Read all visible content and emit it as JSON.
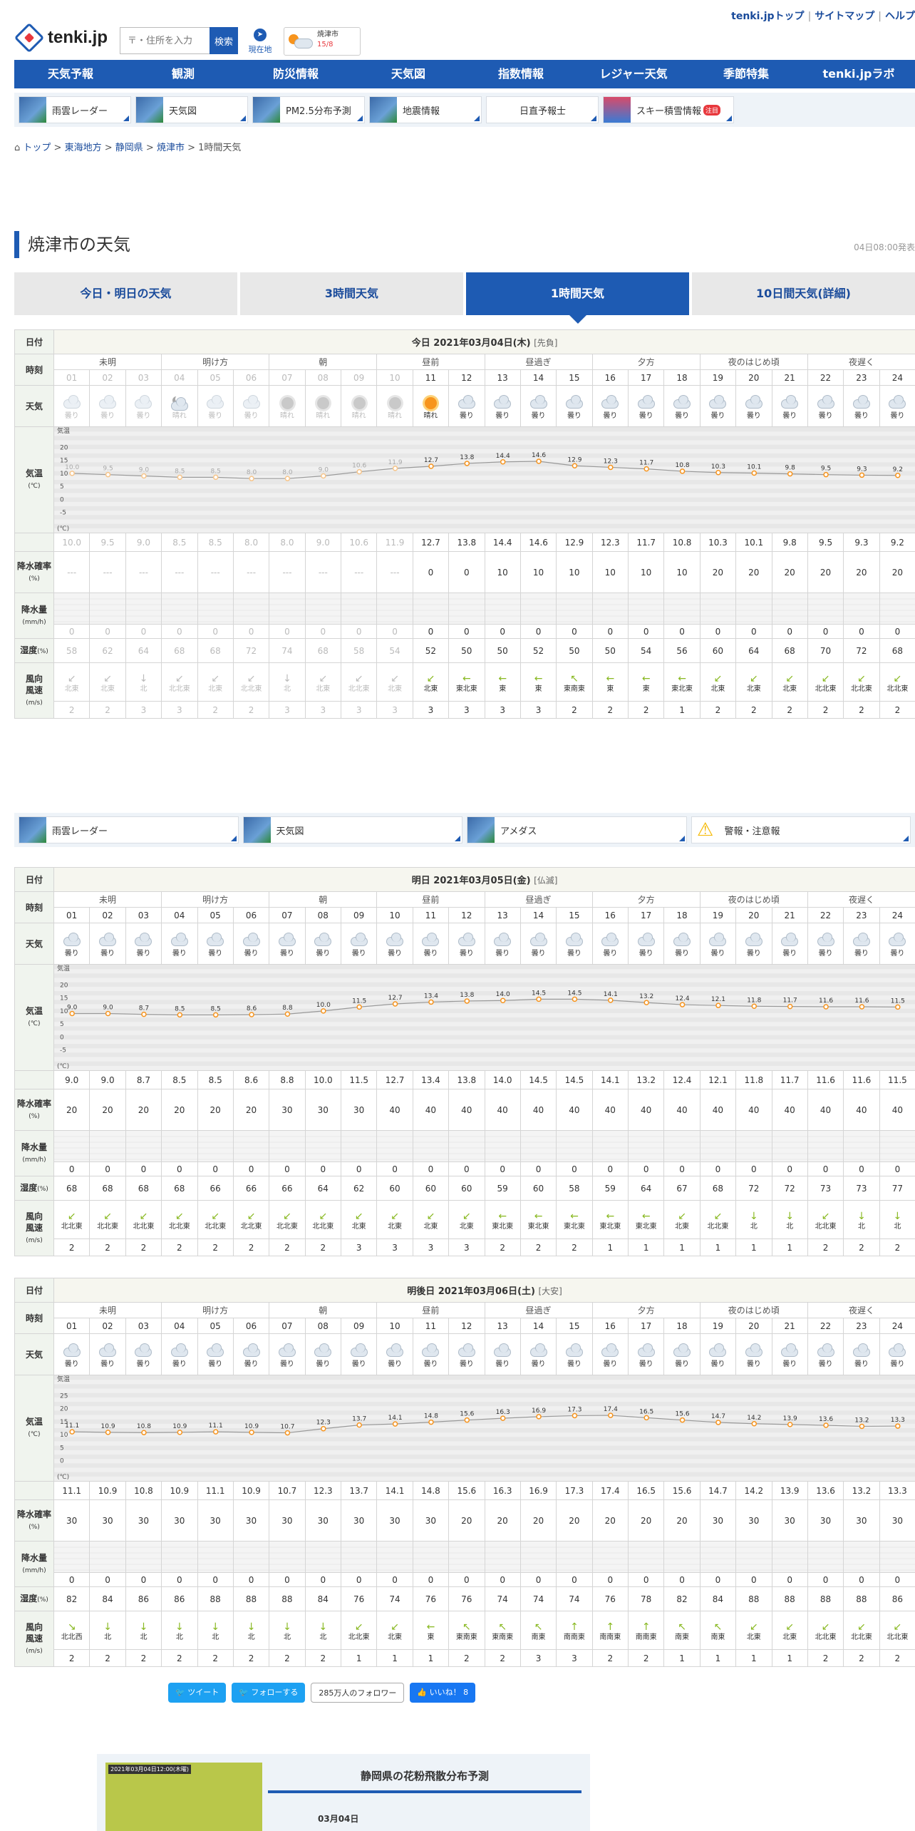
{
  "header": {
    "logo": "tenki.jp",
    "search_placeholder": "〒・住所を入力",
    "search_button": "検索",
    "current_location": "現在地",
    "mini_city": "焼津市",
    "mini_temps": "15/8",
    "top_links": [
      "tenki.jpトップ",
      "サイトマップ",
      "ヘルプ"
    ]
  },
  "global_nav": [
    "天気予報",
    "観測",
    "防災情報",
    "天気図",
    "指数情報",
    "レジャー天気",
    "季節特集",
    "tenki.jpラボ"
  ],
  "sub_nav_1": [
    {
      "label": "雨雲レーダー"
    },
    {
      "label": "天気図"
    },
    {
      "label": "PM2.5分布予測"
    },
    {
      "label": "地震情報"
    },
    {
      "label": "日直予報士"
    },
    {
      "label": "スキー積雪情報",
      "badge": "注目"
    }
  ],
  "sub_nav_2": [
    {
      "label": "雨雲レーダー"
    },
    {
      "label": "天気図"
    },
    {
      "label": "アメダス"
    },
    {
      "label": "警報・注意報"
    }
  ],
  "breadcrumb": [
    "トップ",
    "東海地方",
    "静岡県",
    "焼津市",
    "1時間天気"
  ],
  "page": {
    "title": "焼津市の天気",
    "issued": "04日08:00発表"
  },
  "tabs": [
    "今日・明日の天気",
    "3時間天気",
    "1時間天気",
    "10日間天気(詳細)"
  ],
  "row_labels": {
    "date": "日付",
    "time": "時刻",
    "weather": "天気",
    "temp": "気温",
    "temp_unit": "(℃)",
    "prob": "降水確率",
    "prob_unit": "(%)",
    "precip": "降水量",
    "precip_unit": "(mm/h)",
    "humidity": "湿度",
    "humidity_unit": "(%)",
    "wind_dir": "風向",
    "wind_speed": "風速",
    "wind_unit": "(m/s)"
  },
  "periods": [
    "未明",
    "明け方",
    "朝",
    "昼前",
    "昼過ぎ",
    "夕方",
    "夜のはじめ頃",
    "夜遅く"
  ],
  "hours": [
    "01",
    "02",
    "03",
    "04",
    "05",
    "06",
    "07",
    "08",
    "09",
    "10",
    "11",
    "12",
    "13",
    "14",
    "15",
    "16",
    "17",
    "18",
    "19",
    "20",
    "21",
    "22",
    "23",
    "24"
  ],
  "days": [
    {
      "date_text": "今日 2021年03月04日(木)",
      "rokuyo": "[先負]",
      "past_hours": 10,
      "weather": [
        "曇り",
        "曇り",
        "曇り",
        "晴れ",
        "曇り",
        "曇り",
        "晴れ",
        "晴れ",
        "晴れ",
        "晴れ",
        "晴れ",
        "曇り",
        "曇り",
        "曇り",
        "曇り",
        "曇り",
        "曇り",
        "曇り",
        "曇り",
        "曇り",
        "曇り",
        "曇り",
        "曇り",
        "曇り"
      ],
      "weather_icons": [
        "cloud",
        "cloud",
        "cloud",
        "moon-cloud",
        "cloud",
        "cloud",
        "sun",
        "sun",
        "sun",
        "sun",
        "sun",
        "cloud",
        "cloud",
        "cloud",
        "cloud",
        "cloud",
        "cloud",
        "cloud",
        "cloud",
        "cloud",
        "cloud",
        "cloud",
        "cloud",
        "cloud"
      ],
      "temp": [
        "10.0",
        "9.5",
        "9.0",
        "8.5",
        "8.5",
        "8.0",
        "8.0",
        "9.0",
        "10.6",
        "11.9",
        "12.7",
        "13.8",
        "14.4",
        "14.6",
        "12.9",
        "12.3",
        "11.7",
        "10.8",
        "10.3",
        "10.1",
        "9.8",
        "9.5",
        "9.3",
        "9.2"
      ],
      "temp_axis": [
        "20",
        "15",
        "10",
        "5",
        "0",
        "-5"
      ],
      "prob": [
        "---",
        "---",
        "---",
        "---",
        "---",
        "---",
        "---",
        "---",
        "---",
        "---",
        "0",
        "0",
        "10",
        "10",
        "10",
        "10",
        "10",
        "10",
        "20",
        "20",
        "20",
        "20",
        "20",
        "20"
      ],
      "precip": [
        "0",
        "0",
        "0",
        "0",
        "0",
        "0",
        "0",
        "0",
        "0",
        "0",
        "0",
        "0",
        "0",
        "0",
        "0",
        "0",
        "0",
        "0",
        "0",
        "0",
        "0",
        "0",
        "0",
        "0"
      ],
      "humidity": [
        "58",
        "62",
        "64",
        "68",
        "68",
        "72",
        "74",
        "68",
        "58",
        "54",
        "52",
        "50",
        "50",
        "52",
        "50",
        "50",
        "54",
        "56",
        "60",
        "64",
        "68",
        "70",
        "72",
        "68"
      ],
      "wind_dir": [
        "北東",
        "北東",
        "北",
        "北北東",
        "北東",
        "北北東",
        "北",
        "北東",
        "北北東",
        "北東",
        "北東",
        "東北東",
        "東",
        "東",
        "東南東",
        "東",
        "東",
        "東北東",
        "北東",
        "北東",
        "北東",
        "北北東",
        "北北東",
        "北北東"
      ],
      "wind_speed": [
        "2",
        "2",
        "3",
        "3",
        "2",
        "2",
        "3",
        "3",
        "3",
        "3",
        "3",
        "3",
        "3",
        "3",
        "2",
        "2",
        "2",
        "1",
        "2",
        "2",
        "2",
        "2",
        "2",
        "2"
      ]
    },
    {
      "date_text": "明日 2021年03月05日(金)",
      "rokuyo": "[仏滅]",
      "past_hours": 0,
      "weather": [
        "曇り",
        "曇り",
        "曇り",
        "曇り",
        "曇り",
        "曇り",
        "曇り",
        "曇り",
        "曇り",
        "曇り",
        "曇り",
        "曇り",
        "曇り",
        "曇り",
        "曇り",
        "曇り",
        "曇り",
        "曇り",
        "曇り",
        "曇り",
        "曇り",
        "曇り",
        "曇り",
        "曇り"
      ],
      "weather_icons": [
        "cloud",
        "cloud",
        "cloud",
        "cloud",
        "cloud",
        "cloud",
        "cloud",
        "cloud",
        "cloud",
        "cloud",
        "cloud",
        "cloud",
        "cloud",
        "cloud",
        "cloud",
        "cloud",
        "cloud",
        "cloud",
        "cloud",
        "cloud",
        "cloud",
        "cloud",
        "cloud",
        "cloud"
      ],
      "temp": [
        "9.0",
        "9.0",
        "8.7",
        "8.5",
        "8.5",
        "8.6",
        "8.8",
        "10.0",
        "11.5",
        "12.7",
        "13.4",
        "13.8",
        "14.0",
        "14.5",
        "14.5",
        "14.1",
        "13.2",
        "12.4",
        "12.1",
        "11.8",
        "11.7",
        "11.6",
        "11.6",
        "11.5"
      ],
      "temp_axis": [
        "20",
        "15",
        "10",
        "5",
        "0",
        "-5"
      ],
      "prob": [
        "20",
        "20",
        "20",
        "20",
        "20",
        "20",
        "30",
        "30",
        "30",
        "40",
        "40",
        "40",
        "40",
        "40",
        "40",
        "40",
        "40",
        "40",
        "40",
        "40",
        "40",
        "40",
        "40",
        "40"
      ],
      "precip": [
        "0",
        "0",
        "0",
        "0",
        "0",
        "0",
        "0",
        "0",
        "0",
        "0",
        "0",
        "0",
        "0",
        "0",
        "0",
        "0",
        "0",
        "0",
        "0",
        "0",
        "0",
        "0",
        "0",
        "0"
      ],
      "humidity": [
        "68",
        "68",
        "68",
        "68",
        "66",
        "66",
        "66",
        "64",
        "62",
        "60",
        "60",
        "60",
        "59",
        "60",
        "58",
        "59",
        "64",
        "67",
        "68",
        "72",
        "72",
        "73",
        "73",
        "77"
      ],
      "wind_dir": [
        "北北東",
        "北北東",
        "北北東",
        "北北東",
        "北北東",
        "北北東",
        "北北東",
        "北北東",
        "北東",
        "北東",
        "北東",
        "北東",
        "東北東",
        "東北東",
        "東北東",
        "東北東",
        "東北東",
        "北東",
        "北北東",
        "北",
        "北",
        "北北東",
        "北",
        "北"
      ],
      "wind_speed": [
        "2",
        "2",
        "2",
        "2",
        "2",
        "2",
        "2",
        "2",
        "3",
        "3",
        "3",
        "3",
        "2",
        "2",
        "2",
        "1",
        "1",
        "1",
        "1",
        "1",
        "1",
        "2",
        "2",
        "2"
      ]
    },
    {
      "date_text": "明後日 2021年03月06日(土)",
      "rokuyo": "[大安]",
      "past_hours": 0,
      "weather": [
        "曇り",
        "曇り",
        "曇り",
        "曇り",
        "曇り",
        "曇り",
        "曇り",
        "曇り",
        "曇り",
        "曇り",
        "曇り",
        "曇り",
        "曇り",
        "曇り",
        "曇り",
        "曇り",
        "曇り",
        "曇り",
        "曇り",
        "曇り",
        "曇り",
        "曇り",
        "曇り",
        "曇り"
      ],
      "weather_icons": [
        "cloud",
        "cloud",
        "cloud",
        "cloud",
        "cloud",
        "cloud",
        "cloud",
        "cloud",
        "cloud",
        "cloud",
        "cloud",
        "cloud",
        "cloud",
        "cloud",
        "cloud",
        "cloud",
        "cloud",
        "cloud",
        "cloud",
        "cloud",
        "cloud",
        "cloud",
        "cloud",
        "cloud"
      ],
      "temp": [
        "11.1",
        "10.9",
        "10.8",
        "10.9",
        "11.1",
        "10.9",
        "10.7",
        "12.3",
        "13.7",
        "14.1",
        "14.8",
        "15.6",
        "16.3",
        "16.9",
        "17.3",
        "17.4",
        "16.5",
        "15.6",
        "14.7",
        "14.2",
        "13.9",
        "13.6",
        "13.2",
        "13.3"
      ],
      "temp_axis": [
        "25",
        "20",
        "15",
        "10",
        "5",
        "0"
      ],
      "prob": [
        "30",
        "30",
        "30",
        "30",
        "30",
        "30",
        "30",
        "30",
        "30",
        "30",
        "30",
        "20",
        "20",
        "20",
        "20",
        "20",
        "20",
        "20",
        "30",
        "30",
        "30",
        "30",
        "30",
        "30"
      ],
      "precip": [
        "0",
        "0",
        "0",
        "0",
        "0",
        "0",
        "0",
        "0",
        "0",
        "0",
        "0",
        "0",
        "0",
        "0",
        "0",
        "0",
        "0",
        "0",
        "0",
        "0",
        "0",
        "0",
        "0",
        "0"
      ],
      "humidity": [
        "82",
        "84",
        "86",
        "86",
        "88",
        "88",
        "88",
        "84",
        "76",
        "74",
        "76",
        "76",
        "74",
        "74",
        "74",
        "76",
        "78",
        "82",
        "84",
        "88",
        "88",
        "88",
        "88",
        "86"
      ],
      "wind_dir": [
        "北北西",
        "北",
        "北",
        "北",
        "北",
        "北",
        "北",
        "北",
        "北北東",
        "北東",
        "東",
        "東南東",
        "東南東",
        "南東",
        "南南東",
        "南南東",
        "南南東",
        "南東",
        "南東",
        "北東",
        "北東",
        "北北東",
        "北北東",
        "北北東"
      ],
      "wind_speed": [
        "2",
        "2",
        "2",
        "2",
        "2",
        "2",
        "2",
        "2",
        "1",
        "1",
        "1",
        "2",
        "2",
        "3",
        "3",
        "2",
        "2",
        "1",
        "1",
        "1",
        "1",
        "2",
        "2",
        "2"
      ]
    }
  ],
  "social": {
    "tweet": "ツイート",
    "follow": "フォローする",
    "followers": "285万人のフォロワー",
    "like": "いいね！ 8"
  },
  "pollen": {
    "title": "静岡県の花粉飛散分布予測",
    "date": "03月04日",
    "map_caption": "2021年03月04日12:00(木曜)"
  },
  "colors": {
    "brand": "#1e5bb3",
    "line": "#f7941d",
    "wind": "#88b820"
  }
}
